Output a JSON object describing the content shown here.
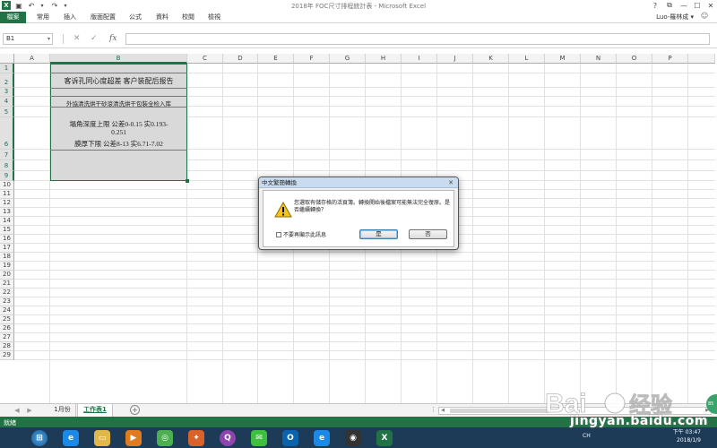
{
  "window": {
    "title": "2018年 FOC尺寸排程統計表 - Microsoft Excel",
    "controls": [
      "?",
      "⧉",
      "—",
      "☐",
      "✕"
    ]
  },
  "ribbon": {
    "file_tab": "檔案",
    "tabs": [
      "常用",
      "插入",
      "版面配置",
      "公式",
      "資料",
      "校閱",
      "檢視"
    ],
    "user": "Luo-羅林成 ▾"
  },
  "formula_bar": {
    "name_box": "B1",
    "cancel_icon": "✕",
    "enter_icon": "✓",
    "fx": "fx",
    "value": ""
  },
  "grid": {
    "columns": [
      "A",
      "B",
      "C",
      "D",
      "E",
      "F",
      "G",
      "H",
      "I",
      "J",
      "K",
      "L",
      "M",
      "N",
      "O",
      "P"
    ],
    "rows": [
      "1",
      "2",
      "3",
      "4",
      "5",
      "6",
      "7",
      "8",
      "9",
      "10",
      "11",
      "12",
      "13",
      "14",
      "15",
      "16",
      "17",
      "18",
      "19",
      "20",
      "21",
      "22",
      "23",
      "24",
      "25",
      "26",
      "27",
      "28",
      "29"
    ],
    "selected_column": "B",
    "selected_rows": [
      "1",
      "2",
      "3",
      "4",
      "5",
      "6",
      "7",
      "8",
      "9"
    ],
    "cells": {
      "B2": "客诉孔同心度超差 客户装配后报告",
      "B4": "外協清洗烘干砂滾清洗烘干包裝全检入库",
      "B6_line1": "塌角深度上限 公差0-0.15  实0.193-",
      "B6_line2": "0.251",
      "B6_line3": "膜厚下限 公差8-13  实6.71-7.02"
    }
  },
  "sheet_tabs": {
    "tabs": [
      "1月份",
      "工作表1"
    ],
    "active": "工作表1",
    "add": "+"
  },
  "status_bar": {
    "text": "就緒"
  },
  "dialog": {
    "title": "中文繁簡轉換",
    "message": "您選取有儲存格的活頁簿。轉換開始後檔案可能無法完全復原。是否繼續轉換？",
    "checkbox_label": "不要再顯示此訊息",
    "yes_label": "是",
    "no_label": "否"
  },
  "taskbar": {
    "icons": [
      "start-icon",
      "ie-icon",
      "folder-icon",
      "media-icon",
      "browser-icon",
      "fox-icon",
      "app-q-icon",
      "wechat-icon",
      "outlook-icon",
      "ie2-icon",
      "camera-icon",
      "excel-icon"
    ],
    "time": "下午 03:47",
    "date": "2018/1/9",
    "tray_lang": "CH"
  },
  "watermark": {
    "url": "jingyan.baidu.com"
  },
  "colors": {
    "excel_green": "#217346",
    "taskbar": "#1d3a56",
    "selection_fill": "#d9d9d9"
  }
}
